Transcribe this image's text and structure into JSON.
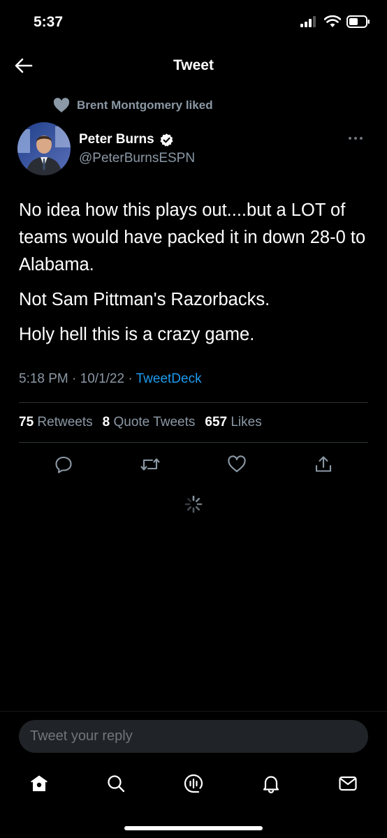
{
  "status_bar": {
    "time": "5:37"
  },
  "header": {
    "title": "Tweet"
  },
  "social_context": {
    "text": "Brent Montgomery liked"
  },
  "author": {
    "name": "Peter Burns",
    "handle": "@PeterBurnsESPN"
  },
  "tweet": {
    "paragraphs": [
      "No idea how this plays out....but a LOT of teams would have packed it in down 28-0 to Alabama.",
      "Not Sam Pittman's Razorbacks.",
      "Holy hell this is a crazy game."
    ],
    "time": "5:18 PM",
    "date": "10/1/22",
    "separator": "·",
    "source": "TweetDeck"
  },
  "stats": {
    "retweets": {
      "count": "75",
      "label": "Retweets"
    },
    "quotes": {
      "count": "8",
      "label": "Quote Tweets"
    },
    "likes": {
      "count": "657",
      "label": "Likes"
    }
  },
  "reply": {
    "placeholder": "Tweet your reply"
  },
  "colors": {
    "accent": "#1d9bf0",
    "muted": "#8b98a5",
    "background": "#000000"
  },
  "icons": [
    "back-arrow-icon",
    "heart-icon",
    "verified-icon",
    "more-icon",
    "reply-icon",
    "retweet-icon",
    "like-icon",
    "share-icon",
    "loading-spinner-icon",
    "home-icon",
    "search-icon",
    "spaces-icon",
    "notifications-icon",
    "messages-icon"
  ]
}
